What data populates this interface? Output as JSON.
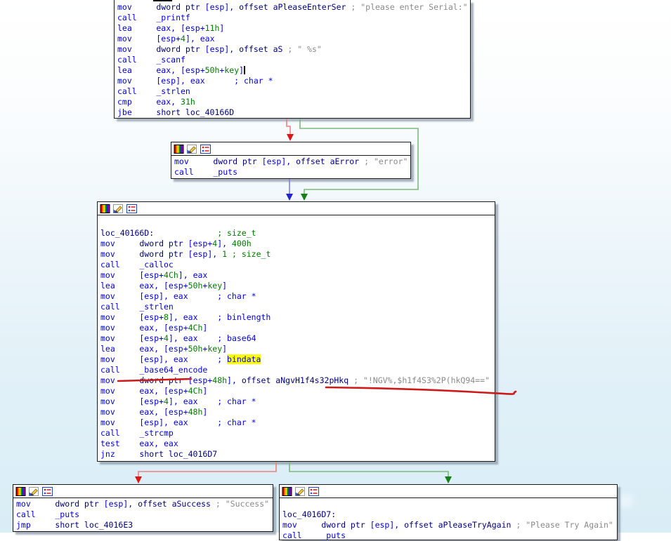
{
  "app": {
    "view": "ida-graph-view"
  },
  "colors": {
    "blue": "#0202dd",
    "navy": "#000080",
    "green": "#007a00",
    "gray": "#8a8a8a",
    "highlight": "#ffff00",
    "red_line": "#f08080",
    "red_head": "#dd1515",
    "green_line": "#7cba7c",
    "green_head": "#158015",
    "blue_line": "#8080e0",
    "blue_head": "#2525cc",
    "annotation": "#cc1a1a"
  },
  "icons": [
    "color-palette-icon",
    "edit-node-icon",
    "group-node-icon"
  ],
  "blocks": {
    "top": {
      "name": "entry-serial-prompt-block",
      "lines": [
        [
          [
            "mov     ",
            "b"
          ],
          [
            "dword ptr ",
            "n"
          ],
          [
            "[esp], ",
            "b"
          ],
          [
            "offset aPleaseEnterSer",
            "n"
          ],
          [
            " ",
            "b"
          ],
          [
            "; \"please enter Serial:\"",
            "c"
          ]
        ],
        [
          [
            "call    _printf",
            "b"
          ]
        ],
        [
          [
            "lea     eax, [esp+",
            "b"
          ],
          [
            "11h",
            "g"
          ],
          [
            "]",
            "b"
          ]
        ],
        [
          [
            "mov     [esp+",
            "b"
          ],
          [
            "4",
            "g"
          ],
          [
            "], eax",
            "b"
          ]
        ],
        [
          [
            "mov     ",
            "b"
          ],
          [
            "dword ptr ",
            "n"
          ],
          [
            "[esp], ",
            "b"
          ],
          [
            "offset aS",
            "n"
          ],
          [
            " ",
            "b"
          ],
          [
            "; \" %s\"",
            "c"
          ]
        ],
        [
          [
            "call    _scanf",
            "b"
          ]
        ],
        [
          [
            "lea     eax, [esp+",
            "b"
          ],
          [
            "50h",
            "g"
          ],
          [
            "+",
            "b"
          ],
          [
            "key",
            "g"
          ],
          [
            "]",
            "b"
          ],
          [
            "",
            "caret"
          ]
        ],
        [
          [
            "mov     [esp], eax      ; char *",
            "b"
          ]
        ],
        [
          [
            "call    _strlen",
            "b"
          ]
        ],
        [
          [
            "cmp     eax, ",
            "b"
          ],
          [
            "31h",
            "g"
          ]
        ],
        [
          [
            "jbe     ",
            "b"
          ],
          [
            "short loc_40166D",
            "n"
          ]
        ]
      ]
    },
    "error": {
      "name": "error-block",
      "lines": [
        [
          [
            "mov     ",
            "b"
          ],
          [
            "dword ptr ",
            "n"
          ],
          [
            "[esp], ",
            "b"
          ],
          [
            "offset aError",
            "n"
          ],
          [
            " ",
            "b"
          ],
          [
            "; \"error\"",
            "c"
          ]
        ],
        [
          [
            "call    _puts",
            "b"
          ]
        ]
      ]
    },
    "main": {
      "name": "loc_40166D-base64-compare-block",
      "lines": [
        [],
        [
          [
            "loc_40166D:",
            "n"
          ],
          [
            "             ",
            "b"
          ],
          [
            "; size_t",
            "g"
          ]
        ],
        [
          [
            "mov     ",
            "b"
          ],
          [
            "dword ptr ",
            "n"
          ],
          [
            "[esp+",
            "b"
          ],
          [
            "4",
            "g"
          ],
          [
            "], ",
            "b"
          ],
          [
            "400h",
            "g"
          ]
        ],
        [
          [
            "mov     ",
            "b"
          ],
          [
            "dword ptr ",
            "n"
          ],
          [
            "[esp], ",
            "b"
          ],
          [
            "1",
            "g"
          ],
          [
            " ",
            "b"
          ],
          [
            "; size_t",
            "g"
          ]
        ],
        [
          [
            "call    _calloc",
            "b"
          ]
        ],
        [
          [
            "mov     [esp+",
            "b"
          ],
          [
            "4Ch",
            "g"
          ],
          [
            "], eax",
            "b"
          ]
        ],
        [
          [
            "lea     eax, [esp+",
            "b"
          ],
          [
            "50h",
            "g"
          ],
          [
            "+",
            "b"
          ],
          [
            "key",
            "g"
          ],
          [
            "]",
            "b"
          ]
        ],
        [
          [
            "mov     [esp], eax      ; char *",
            "b"
          ]
        ],
        [
          [
            "call    _strlen",
            "b"
          ]
        ],
        [
          [
            "mov     [esp+",
            "b"
          ],
          [
            "8",
            "g"
          ],
          [
            "], eax    ; binlength",
            "b"
          ]
        ],
        [
          [
            "mov     eax, [esp+",
            "b"
          ],
          [
            "4Ch",
            "g"
          ],
          [
            "]",
            "b"
          ]
        ],
        [
          [
            "mov     [esp+",
            "b"
          ],
          [
            "4",
            "g"
          ],
          [
            "], eax    ; base64",
            "b"
          ]
        ],
        [
          [
            "lea     eax, [esp+",
            "b"
          ],
          [
            "50h",
            "g"
          ],
          [
            "+",
            "b"
          ],
          [
            "key",
            "g"
          ],
          [
            "]",
            "b"
          ]
        ],
        [
          [
            "mov     [esp], eax      ; ",
            "b"
          ],
          [
            "bindata",
            "hl"
          ]
        ],
        [
          [
            "call    _base64_encode",
            "b"
          ]
        ],
        [
          [
            "mov     ",
            "b"
          ],
          [
            "dword ptr ",
            "n"
          ],
          [
            "[esp+",
            "b"
          ],
          [
            "48h",
            "g"
          ],
          [
            "], ",
            "b"
          ],
          [
            "offset aNgvH1f4s32pHkq",
            "n"
          ],
          [
            " ",
            "b"
          ],
          [
            "; \"!NGV%,$h1f4S3%2P(hkQ94==\"",
            "c"
          ]
        ],
        [
          [
            "mov     eax, [esp+",
            "b"
          ],
          [
            "4Ch",
            "g"
          ],
          [
            "]",
            "b"
          ]
        ],
        [
          [
            "mov     [esp+",
            "b"
          ],
          [
            "4",
            "g"
          ],
          [
            "], eax    ; char *",
            "b"
          ]
        ],
        [
          [
            "mov     eax, [esp+",
            "b"
          ],
          [
            "48h",
            "g"
          ],
          [
            "]",
            "b"
          ]
        ],
        [
          [
            "mov     [esp], eax      ; char *",
            "b"
          ]
        ],
        [
          [
            "call    _strcmp",
            "b"
          ]
        ],
        [
          [
            "test    eax, eax",
            "b"
          ]
        ],
        [
          [
            "jnz     ",
            "b"
          ],
          [
            "short loc_4016D7",
            "n"
          ]
        ]
      ]
    },
    "success": {
      "name": "success-block",
      "lines": [
        [
          [
            "mov     ",
            "b"
          ],
          [
            "dword ptr ",
            "n"
          ],
          [
            "[esp], ",
            "b"
          ],
          [
            "offset aSuccess",
            "n"
          ],
          [
            " ",
            "b"
          ],
          [
            "; \"Success\"",
            "c"
          ]
        ],
        [
          [
            "call    _puts",
            "b"
          ]
        ],
        [
          [
            "jmp     ",
            "b"
          ],
          [
            "short loc_4016E3",
            "n"
          ]
        ]
      ]
    },
    "tryagain": {
      "name": "loc_4016D7-try-again-block",
      "lines": [
        [],
        [
          [
            "loc_4016D7:",
            "n"
          ]
        ],
        [
          [
            "mov     ",
            "b"
          ],
          [
            "dword ptr ",
            "n"
          ],
          [
            "[esp], ",
            "b"
          ],
          [
            "offset aPleaseTryAgain",
            "n"
          ],
          [
            " ",
            "b"
          ],
          [
            "; \"Please Try Again\"",
            "c"
          ]
        ],
        [
          [
            "call    _puts",
            "b"
          ]
        ]
      ]
    }
  }
}
